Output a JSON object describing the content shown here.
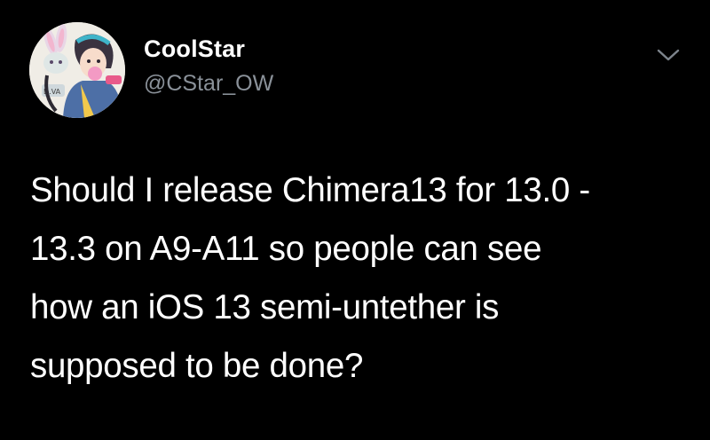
{
  "tweet": {
    "author": {
      "display_name": "CoolStar",
      "handle": "@CStar_OW",
      "avatar_icon": "anime-avatar-icon"
    },
    "menu_icon": "chevron-down-icon",
    "text_lines": [
      "Should I release Chimera13 for 13.0 -",
      "13.3 on A9-A11 so people can see",
      "how an iOS 13 semi-untether is",
      "supposed to be done?"
    ]
  },
  "colors": {
    "background": "#000000",
    "text_primary": "#ffffff",
    "text_secondary": "#8a9199"
  }
}
